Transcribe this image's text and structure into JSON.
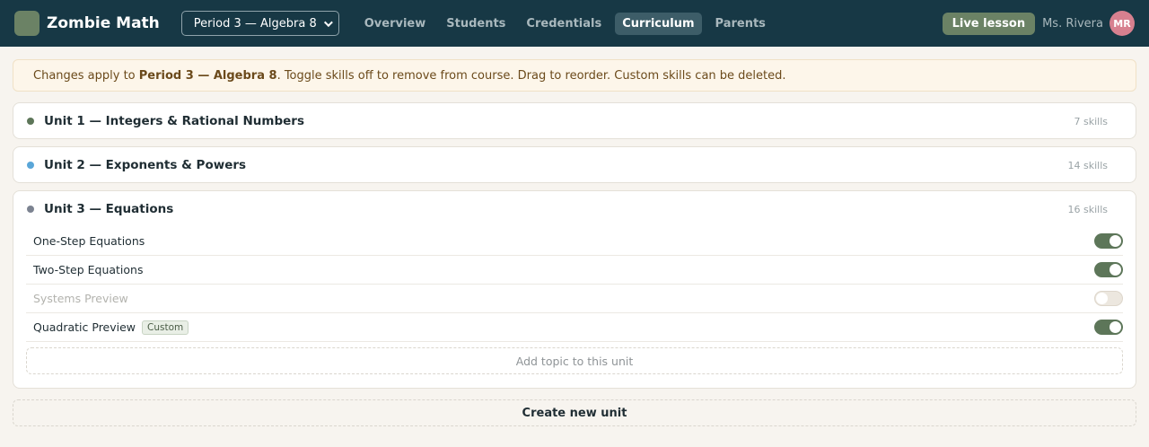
{
  "app": {
    "name": "Zombie Math"
  },
  "period_select": {
    "value": "Period 3 — Algebra 8"
  },
  "nav": [
    {
      "label": "Overview",
      "active": false
    },
    {
      "label": "Students",
      "active": false
    },
    {
      "label": "Credentials",
      "active": false
    },
    {
      "label": "Curriculum",
      "active": true
    },
    {
      "label": "Parents",
      "active": false
    }
  ],
  "header": {
    "live_label": "Live lesson",
    "teacher": "Ms. Rivera",
    "initials": "MR"
  },
  "notice": {
    "prefix": "Changes apply to ",
    "course": "Period 3 — Algebra 8",
    "suffix": ". Toggle skills off to remove from course. Drag to reorder. Custom skills can be deleted."
  },
  "units": [
    {
      "title": "Unit 1 — Integers & Rational Numbers",
      "count": "7 skills",
      "color": "#5d7659",
      "expanded": false
    },
    {
      "title": "Unit 2 — Exponents & Powers",
      "count": "14 skills",
      "color": "#5aa6d8",
      "expanded": false
    },
    {
      "title": "Unit 3 — Equations",
      "count": "16 skills",
      "color": "#7c8391",
      "expanded": true,
      "topics": [
        {
          "label": "One-Step Equations",
          "enabled": true,
          "custom": false
        },
        {
          "label": "Two-Step Equations",
          "enabled": true,
          "custom": false
        },
        {
          "label": "Systems Preview",
          "enabled": false,
          "custom": false
        },
        {
          "label": "Quadratic Preview",
          "enabled": true,
          "custom": true,
          "tag": "Custom"
        }
      ],
      "add_topic_label": "Add topic to this unit"
    }
  ],
  "create_unit_label": "Create new unit"
}
